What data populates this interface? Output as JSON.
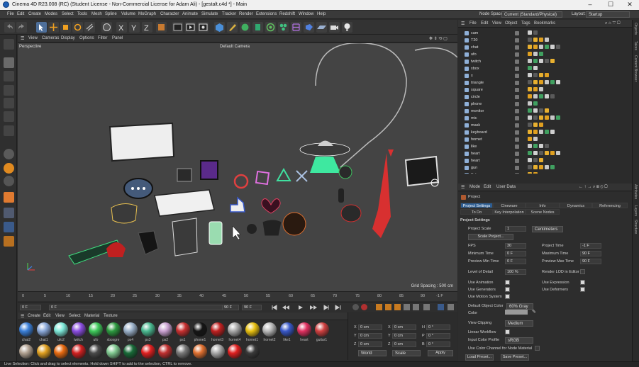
{
  "window": {
    "title": "Cinema 4D R23.008 (RC) (Student License - Non-Commercial License for Adam Ali) - [gestalt.c4d *] - Main",
    "minimize": "–",
    "maximize": "☐",
    "close": "✕"
  },
  "menu": [
    "File",
    "Edit",
    "Create",
    "Modes",
    "Select",
    "Tools",
    "Mesh",
    "Spline",
    "Volume",
    "MoGraph",
    "Character",
    "Animate",
    "Simulate",
    "Tracker",
    "Render",
    "Extensions",
    "Redshift",
    "Window",
    "Help"
  ],
  "node_space": {
    "label": "Node Space:",
    "value": "Current (Standard/Physical)"
  },
  "layout": {
    "label": "Layout:",
    "value": "Startup"
  },
  "viewport": {
    "menu": [
      "View",
      "Cameras",
      "Display",
      "Options",
      "Filter",
      "Panel"
    ],
    "name": "Perspective",
    "camera": "Default Camera",
    "grid_spacing": "Grid Spacing : 500 cm"
  },
  "timeline": {
    "ticks": [
      "0",
      "5",
      "10",
      "15",
      "20",
      "25",
      "30",
      "35",
      "40",
      "45",
      "50",
      "55",
      "60",
      "65",
      "70",
      "75",
      "80",
      "85",
      "90"
    ],
    "end_frame": "-1 F"
  },
  "timectl": {
    "start": "0 F",
    "cur": "0 F",
    "end": "90 F",
    "end2": "90 F"
  },
  "materials": {
    "menu": [
      "Create",
      "Edit",
      "View",
      "Select",
      "Material",
      "Texture"
    ],
    "row1": [
      {
        "name": "chat2",
        "color": "#3a7fd8"
      },
      {
        "name": "chat1",
        "color": "#8aa8d8"
      },
      {
        "name": "ufo2",
        "color": "#7de8d8"
      },
      {
        "name": "twitch",
        "color": "#8a4de0"
      },
      {
        "name": "ufo",
        "color": "#3ec85a"
      },
      {
        "name": "xboxgre",
        "color": "#2d9a40"
      },
      {
        "name": "ps4",
        "color": "#9ab0c8"
      },
      {
        "name": "ps3",
        "color": "#4ab890"
      },
      {
        "name": "ps2",
        "color": "#c8a0d0"
      },
      {
        "name": "ps1",
        "color": "#c83030"
      },
      {
        "name": "phone1",
        "color": "#151515"
      },
      {
        "name": "hornet3",
        "color": "#c02020"
      },
      {
        "name": "hornet4",
        "color": "#a8a8a8"
      },
      {
        "name": "hornet1",
        "color": "#e8c010"
      },
      {
        "name": "hornet2",
        "color": "#b8b8b8"
      },
      {
        "name": "like1",
        "color": "#3858c8"
      },
      {
        "name": "heart",
        "color": "#e03060"
      },
      {
        "name": "guitar1",
        "color": "#d04040"
      }
    ],
    "row2": [
      "#b0a090",
      "#e0a020",
      "#e86a10",
      "#d02020",
      "#4a4a4a",
      "#80c890",
      "#186a38",
      "#e02020",
      "#c03030",
      "#787878",
      "#e07030",
      "#a8a8a8",
      "#e02020",
      "#3a3a3a"
    ]
  },
  "coords": {
    "labels": [
      "X",
      "Y",
      "Z"
    ],
    "pos": [
      "0 cm",
      "0 cm",
      "0 cm"
    ],
    "size": [
      "0 cm",
      "0 cm",
      "0 cm"
    ],
    "rot_labels": [
      "H",
      "P",
      "B"
    ],
    "rot": [
      "0 °",
      "0 °",
      "0 °"
    ],
    "mode1": "World",
    "mode2": "Scale",
    "apply": "Apply"
  },
  "objmgr": {
    "menu": [
      "File",
      "Edit",
      "View",
      "Object",
      "Tags",
      "Bookmarks"
    ],
    "objects": [
      "cam",
      "T20",
      "chat",
      "ufo",
      "twitch",
      "xbox",
      "x",
      "triangle",
      "square",
      "circle",
      "phone",
      "monitor",
      "mic",
      "mask",
      "keyboard",
      "hornet",
      "like",
      "heart",
      "heart",
      "gun",
      "Tube"
    ]
  },
  "attr": {
    "menu": [
      "Mode",
      "Edit",
      "User Data"
    ],
    "title": "Project",
    "tabs1": [
      "Project Settings",
      "Cineware",
      "Info",
      "Dynamics",
      "Referencing"
    ],
    "tabs2": [
      "To Do",
      "Key Interpolation",
      "Scene Nodes"
    ],
    "section": "Project Settings",
    "project_scale": {
      "label": "Project Scale",
      "value": "1",
      "unit": "Centimeters"
    },
    "scale_project": "Scale Project...",
    "fps": {
      "label": "FPS",
      "value": "30"
    },
    "project_time": {
      "label": "Project Time",
      "value": "-1 F"
    },
    "min_time": {
      "label": "Minimum Time",
      "value": "0 F"
    },
    "max_time": {
      "label": "Maximum Time",
      "value": "90 F"
    },
    "prev_min": {
      "label": "Preview Min Time",
      "value": "0 F"
    },
    "prev_max": {
      "label": "Preview Max Time",
      "value": "90 F"
    },
    "lod": {
      "label": "Level of Detail",
      "value": "100 %"
    },
    "render_lod": "Render LOD in Editor",
    "use_anim": "Use Animation",
    "use_expr": "Use Expression",
    "use_gen": "Use Generators",
    "use_def": "Use Deformers",
    "use_motion": "Use Motion System",
    "def_color": {
      "label": "Default Object Color",
      "value": "60% Gray"
    },
    "color": "Color",
    "view_clip": {
      "label": "View Clipping",
      "value": "Medium"
    },
    "linear": "Linear Workflow",
    "input_color": {
      "label": "Input Color Profile",
      "value": "sRGB"
    },
    "use_color_ch": "Use Color Channel for Node Material",
    "load_preset": "Load Preset...",
    "save_preset": "Save Preset..."
  },
  "sidetabs": [
    "Objects",
    "Takes",
    "Content Browser",
    "Attributes",
    "Layers",
    "Structure"
  ],
  "status": "Live Selection: Click and drag to select elements. Hold down SHIFT to add to the selection, CTRL to remove."
}
